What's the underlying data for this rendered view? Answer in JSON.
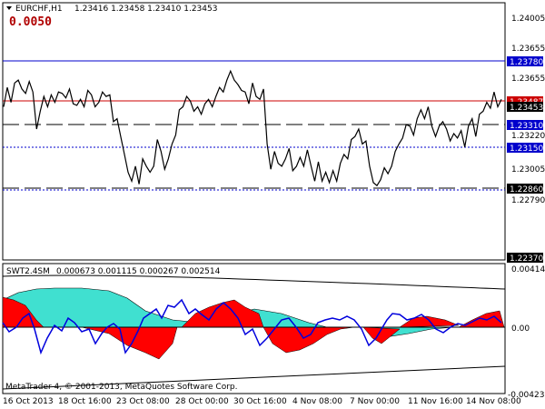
{
  "header": {
    "symbol": "EURCHF,H1",
    "ohlc": "1.23416 1.23458 1.23410 1.23453",
    "big_value": "0.0050"
  },
  "price_axis": {
    "ticks": [
      "1.24005",
      "1.23780",
      "1.23655",
      "1.23487",
      "1.23453",
      "1.23310",
      "1.23220",
      "1.23150",
      "1.23005",
      "1.22860",
      "1.22790",
      "1.22370"
    ]
  },
  "price_levels": {
    "blue_top": "1.23780",
    "red_upper": "1.23487",
    "current": "1.23453",
    "dash_upper": "1.23310",
    "blue_dotted": "1.23150",
    "dash_lower": "1.22860",
    "bottom": "1.22370"
  },
  "indicator": {
    "name": "SWT2.4SM",
    "values": "0.000673 0.001115 0.000267 0.002514",
    "axis_ticks": [
      "0.004147",
      "0.00",
      "-0.004232"
    ]
  },
  "footer": {
    "copyright": "MetaTrader 4, © 2001-2013, MetaQuotes Software Corp."
  },
  "time_axis": {
    "labels": [
      "16 Oct 2013",
      "18 Oct 16:00",
      "23 Oct 08:00",
      "28 Oct 00:00",
      "30 Oct 16:00",
      "4 Nov 08:00",
      "7 Nov 00:00",
      "11 Nov 16:00",
      "14 Nov 08:00"
    ]
  },
  "colors": {
    "background": "#ffffff",
    "price_line": "#000000",
    "red_level": "#cc0000",
    "blue_level": "#0000cc",
    "aqua_fill": "#40e0d0",
    "red_fill": "#ff0000",
    "indicator_line": "#0000dd"
  },
  "chart_data": [
    {
      "type": "line",
      "x": [
        0,
        4,
        8,
        12,
        16,
        20,
        24,
        28,
        32,
        36,
        40,
        44,
        48,
        52,
        56,
        60,
        64,
        68,
        72,
        76,
        80,
        84,
        88,
        92,
        96,
        100,
        104,
        108,
        112,
        116,
        120,
        124,
        128,
        132,
        136,
        140,
        144,
        148,
        152,
        156,
        160,
        164,
        168,
        172,
        176,
        180,
        184,
        188,
        192,
        196,
        200,
        204,
        208,
        212,
        216,
        220,
        224,
        228,
        232,
        236,
        240,
        244,
        248,
        252,
        256,
        260,
        264,
        268,
        272,
        276,
        280,
        284,
        288,
        292,
        296,
        300,
        304,
        308,
        312,
        316,
        320,
        324,
        328,
        332,
        336,
        340,
        344,
        348,
        352,
        356,
        360,
        364,
        368,
        372,
        376,
        380,
        384,
        388,
        392,
        396,
        400,
        404,
        408,
        412,
        416,
        420,
        424,
        428,
        432,
        436,
        440,
        444,
        448,
        452,
        456,
        460,
        464,
        468,
        472,
        476,
        480,
        484,
        488,
        492,
        496,
        500,
        504,
        508,
        512,
        516,
        520,
        524,
        528,
        532,
        536,
        540,
        544
      ],
      "values": [
        1.234,
        1.2353,
        1.2343,
        1.2356,
        1.2358,
        1.2352,
        1.2349,
        1.2357,
        1.235,
        1.2325,
        1.2337,
        1.2347,
        1.234,
        1.2348,
        1.2343,
        1.235,
        1.2349,
        1.2346,
        1.2352,
        1.2342,
        1.2341,
        1.2345,
        1.234,
        1.2351,
        1.2348,
        1.234,
        1.2343,
        1.235,
        1.2347,
        1.2348,
        1.233,
        1.2332,
        1.232,
        1.2308,
        1.2296,
        1.229,
        1.23,
        1.2288,
        1.2305,
        1.23,
        1.2296,
        1.23,
        1.2318,
        1.231,
        1.2298,
        1.2305,
        1.2315,
        1.2321,
        1.2338,
        1.234,
        1.2347,
        1.2344,
        1.2337,
        1.234,
        1.2335,
        1.2342,
        1.2345,
        1.234,
        1.2347,
        1.2353,
        1.235,
        1.2358,
        1.2364,
        1.2358,
        1.2355,
        1.2351,
        1.235,
        1.2342,
        1.2356,
        1.2347,
        1.2345,
        1.2352,
        1.2315,
        1.2298,
        1.231,
        1.2302,
        1.23,
        1.2305,
        1.2312,
        1.2297,
        1.23,
        1.2306,
        1.23,
        1.2311,
        1.23,
        1.229,
        1.2303,
        1.229,
        1.2296,
        1.2289,
        1.2297,
        1.229,
        1.2302,
        1.2308,
        1.2305,
        1.2318,
        1.232,
        1.2325,
        1.2315,
        1.2317,
        1.23,
        1.2289,
        1.2287,
        1.2291,
        1.2299,
        1.2295,
        1.23,
        1.231,
        1.2315,
        1.2319,
        1.2328,
        1.2327,
        1.2321,
        1.2332,
        1.2338,
        1.2332,
        1.234,
        1.2327,
        1.232,
        1.2327,
        1.233,
        1.2325,
        1.2317,
        1.2322,
        1.2319,
        1.2324,
        1.2313,
        1.2327,
        1.2332,
        1.232,
        1.2335,
        1.2337,
        1.2343,
        1.2339,
        1.235,
        1.234,
        1.2345
      ]
    }
  ]
}
